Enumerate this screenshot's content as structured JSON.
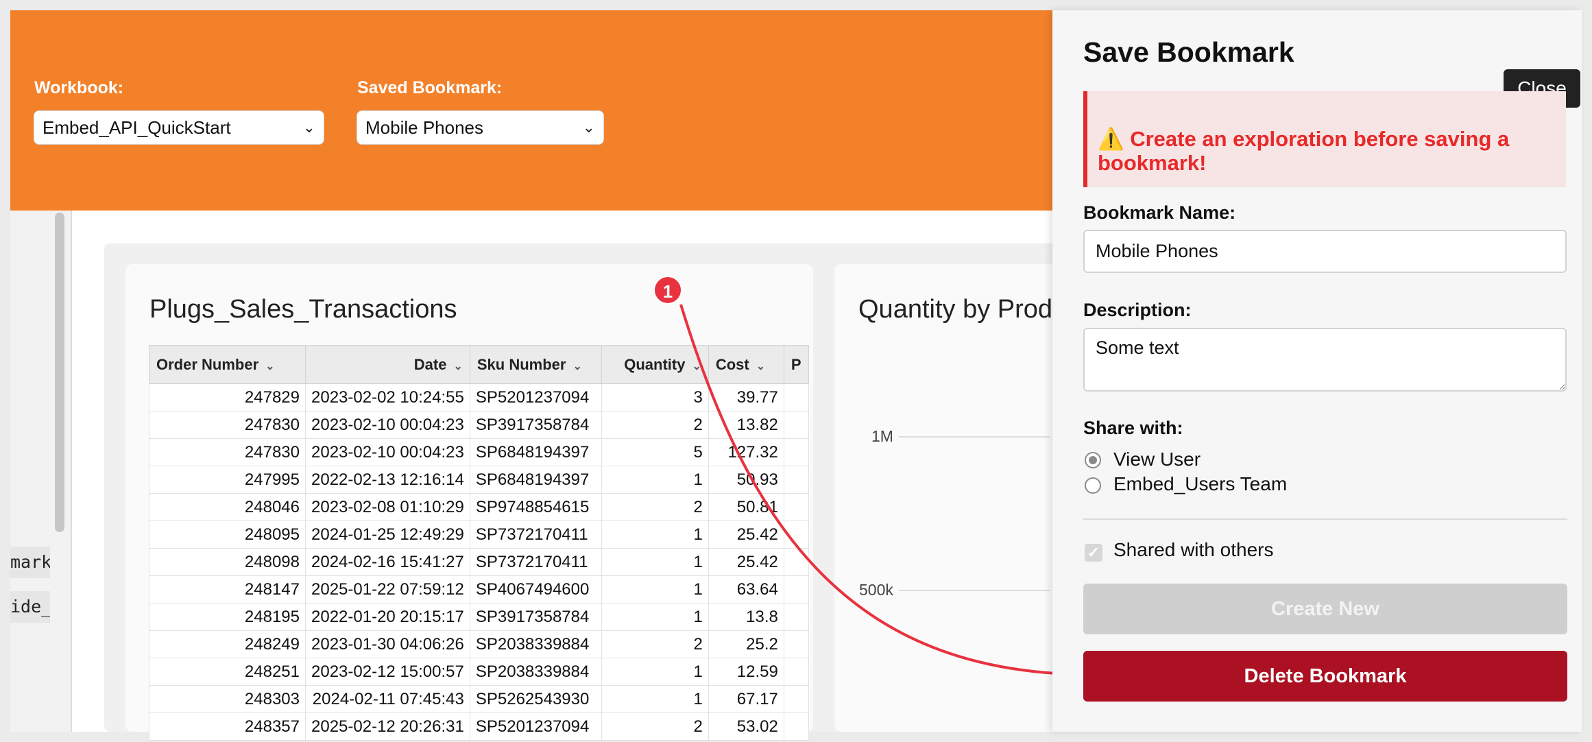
{
  "toolbar": {
    "workbook_label": "Workbook:",
    "workbook_value": "Embed_API_QuickStart",
    "bookmark_label": "Saved Bookmark:",
    "bookmark_value": "Mobile Phones"
  },
  "sidebar_snippets": [
    "mark",
    "ide_"
  ],
  "table_card": {
    "title": "Plugs_Sales_Transactions",
    "columns": [
      "Order Number",
      "Date",
      "Sku Number",
      "Quantity",
      "Cost",
      "P"
    ],
    "rows": [
      [
        "247829",
        "2023-02-02 10:24:55",
        "SP5201237094",
        "3",
        "39.77"
      ],
      [
        "247830",
        "2023-02-10 00:04:23",
        "SP3917358784",
        "2",
        "13.82"
      ],
      [
        "247830",
        "2023-02-10 00:04:23",
        "SP6848194397",
        "5",
        "127.32"
      ],
      [
        "247995",
        "2022-02-13 12:16:14",
        "SP6848194397",
        "1",
        "50.93"
      ],
      [
        "248046",
        "2023-02-08 01:10:29",
        "SP9748854615",
        "2",
        "50.81"
      ],
      [
        "248095",
        "2024-01-25 12:49:29",
        "SP7372170411",
        "1",
        "25.42"
      ],
      [
        "248098",
        "2024-02-16 15:41:27",
        "SP7372170411",
        "1",
        "25.42"
      ],
      [
        "248147",
        "2025-01-22 07:59:12",
        "SP4067494600",
        "1",
        "63.64"
      ],
      [
        "248195",
        "2022-01-20 20:15:17",
        "SP3917358784",
        "1",
        "13.8"
      ],
      [
        "248249",
        "2023-01-30 04:06:26",
        "SP2038339884",
        "2",
        "25.2"
      ],
      [
        "248251",
        "2023-02-12 15:00:57",
        "SP2038339884",
        "1",
        "12.59"
      ],
      [
        "248303",
        "2024-02-11 07:45:43",
        "SP5262543930",
        "1",
        "67.17"
      ],
      [
        "248357",
        "2025-02-12 20:26:31",
        "SP5201237094",
        "2",
        "53.02"
      ]
    ]
  },
  "chart_card": {
    "title": "Quantity by Prod",
    "ticks": [
      "1M",
      "500k"
    ]
  },
  "panel": {
    "title": "Save Bookmark",
    "close_label": "Close",
    "alert_icon": "warning-icon",
    "alert_glyph": "⚠️",
    "alert_text": "Create an exploration before saving a bookmark!",
    "name_label": "Bookmark Name:",
    "name_value": "Mobile Phones",
    "description_label": "Description:",
    "description_value": "Some text",
    "share_label": "Share with:",
    "share_options": [
      "View User",
      "Embed_Users Team"
    ],
    "shared_label": "Shared with others",
    "create_label": "Create New",
    "delete_label": "Delete Bookmark"
  },
  "annotation": {
    "badge": "1"
  },
  "colors": {
    "header": "#f3812a",
    "alert_text": "#e8292a",
    "delete_button": "#ab1122",
    "annotation": "#e8323f"
  }
}
